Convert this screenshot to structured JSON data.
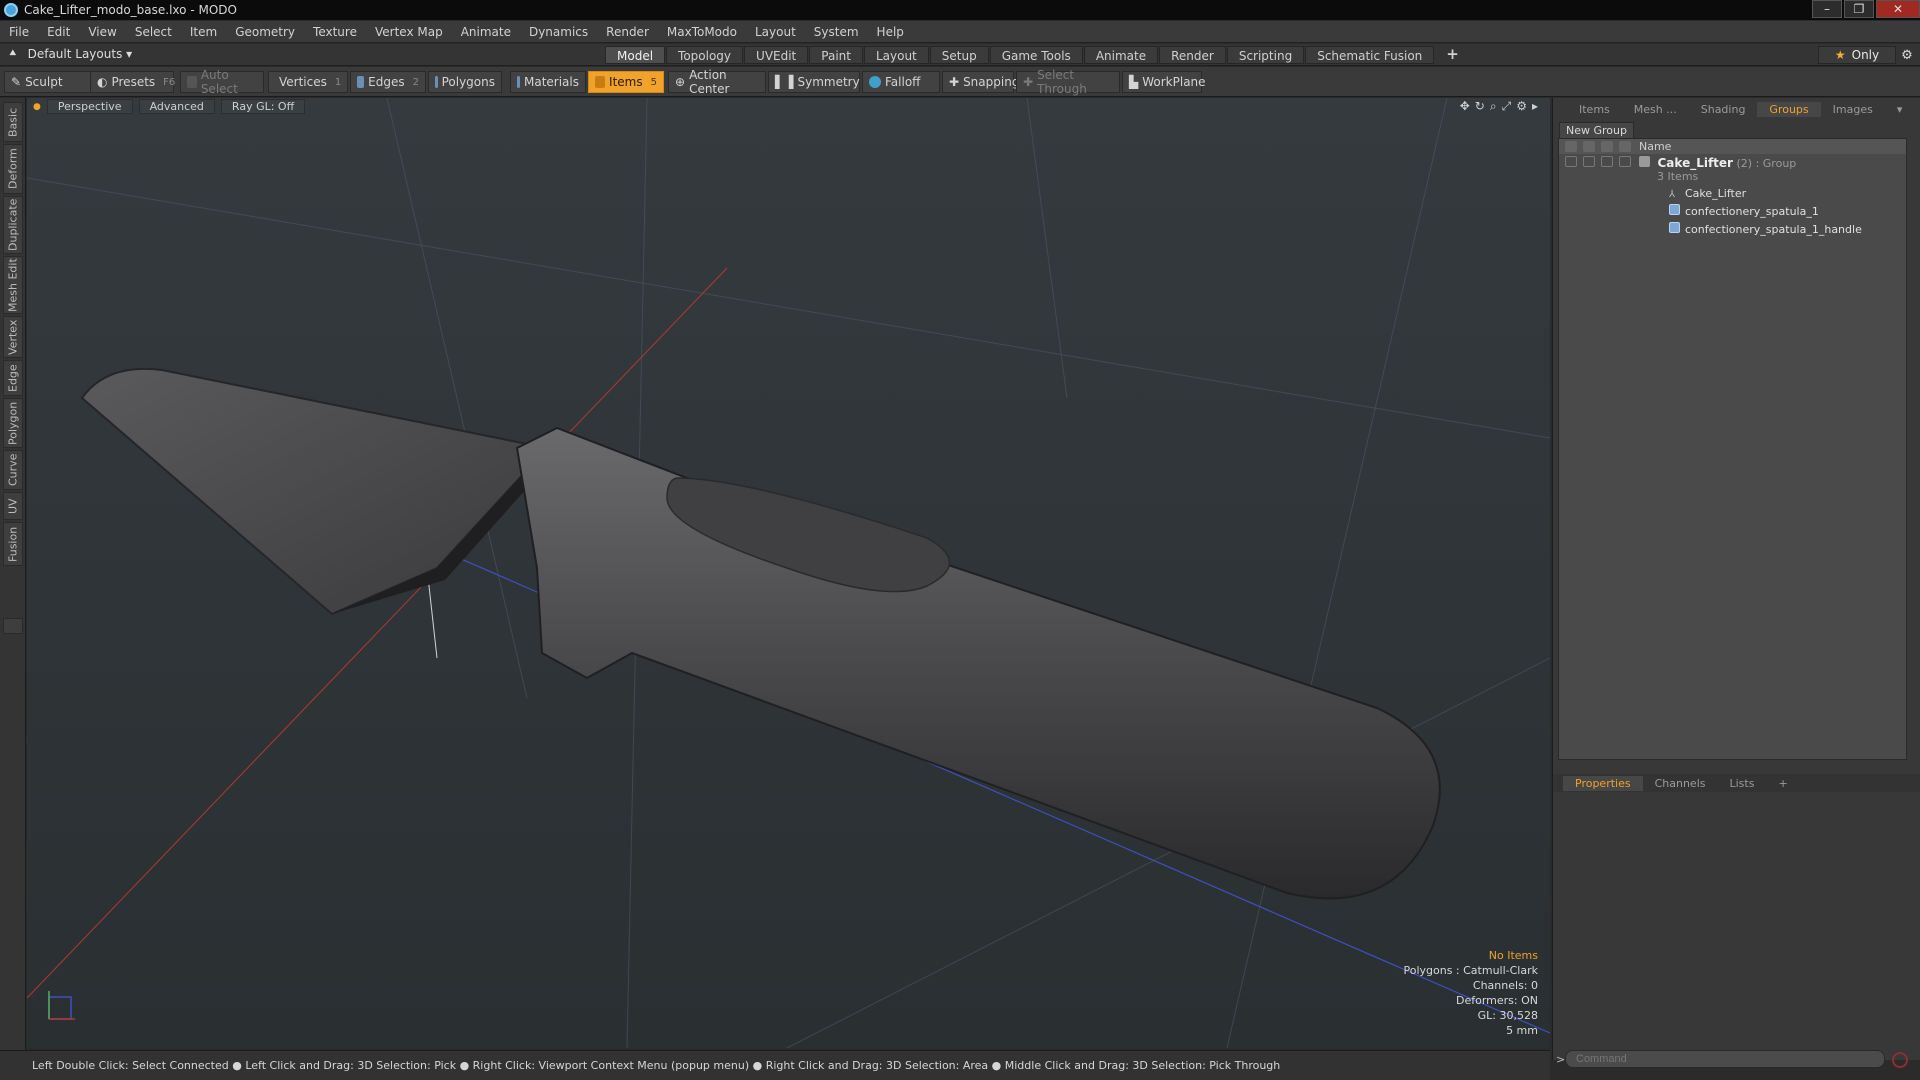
{
  "window": {
    "title": "Cake_Lifter_modo_base.lxo - MODO",
    "controls": [
      "–",
      "❐",
      "✕"
    ]
  },
  "menu": [
    "File",
    "Edit",
    "View",
    "Select",
    "Item",
    "Geometry",
    "Texture",
    "Vertex Map",
    "Animate",
    "Dynamics",
    "Render",
    "MaxToModo",
    "Layout",
    "System",
    "Help"
  ],
  "layouts": {
    "label": "Default Layouts ▾"
  },
  "tabs": [
    {
      "label": "Model",
      "active": true
    },
    {
      "label": "Topology"
    },
    {
      "label": "UVEdit"
    },
    {
      "label": "Paint"
    },
    {
      "label": "Layout"
    },
    {
      "label": "Setup"
    },
    {
      "label": "Game Tools"
    },
    {
      "label": "Animate"
    },
    {
      "label": "Render"
    },
    {
      "label": "Scripting"
    },
    {
      "label": "Schematic Fusion"
    }
  ],
  "only": {
    "label": "Only"
  },
  "toolbar": {
    "sculpt": "Sculpt",
    "presets": "Presets",
    "presets_key": "F6",
    "auto_select": "Auto Select",
    "vertices": "Vertices",
    "vertices_key": "1",
    "edges": "Edges",
    "edges_key": "2",
    "polygons": "Polygons",
    "materials": "Materials",
    "items": "Items",
    "items_key": "5",
    "action_center": "Action Center",
    "symmetry": "Symmetry",
    "falloff": "Falloff",
    "snapping": "Snapping",
    "select_through": "Select Through",
    "workplane": "WorkPlane"
  },
  "left_tabs": [
    "Basic",
    "Deform",
    "Duplicate",
    "Mesh Edit",
    "Vertex",
    "Edge",
    "Polygon",
    "Curve",
    "UV",
    "Fusion"
  ],
  "viewport": {
    "perspective": "Perspective",
    "advanced": "Advanced",
    "raygl": "Ray GL: Off",
    "info": {
      "no_items": "No Items",
      "polygons": "Polygons : Catmull-Clark",
      "channels": "Channels: 0",
      "deformers": "Deformers: ON",
      "gl": "GL: 30,528",
      "scale": "5 mm"
    }
  },
  "right_tabs": [
    {
      "label": "Items"
    },
    {
      "label": "Mesh ..."
    },
    {
      "label": "Shading"
    },
    {
      "label": "Groups",
      "active": true
    },
    {
      "label": "Images"
    }
  ],
  "groups": {
    "new_group": "New Group",
    "name_header": "Name",
    "group_name": "Cake_Lifter",
    "group_count": "(2)",
    "group_type": ": Group",
    "group_items": "3 Items",
    "children": [
      "Cake_Lifter",
      "confectionery_spatula_1",
      "confectionery_spatula_1_handle"
    ]
  },
  "prop_tabs": [
    {
      "label": "Properties",
      "active": true
    },
    {
      "label": "Channels"
    },
    {
      "label": "Lists"
    },
    {
      "label": "+"
    }
  ],
  "command": {
    "placeholder": "Command"
  },
  "status": "Left Double Click: Select Connected ● Left Click and Drag: 3D Selection: Pick ● Right Click: Viewport Context Menu (popup menu) ● Right Click and Drag: 3D Selection: Area ● Middle Click and Drag: 3D Selection: Pick Through"
}
